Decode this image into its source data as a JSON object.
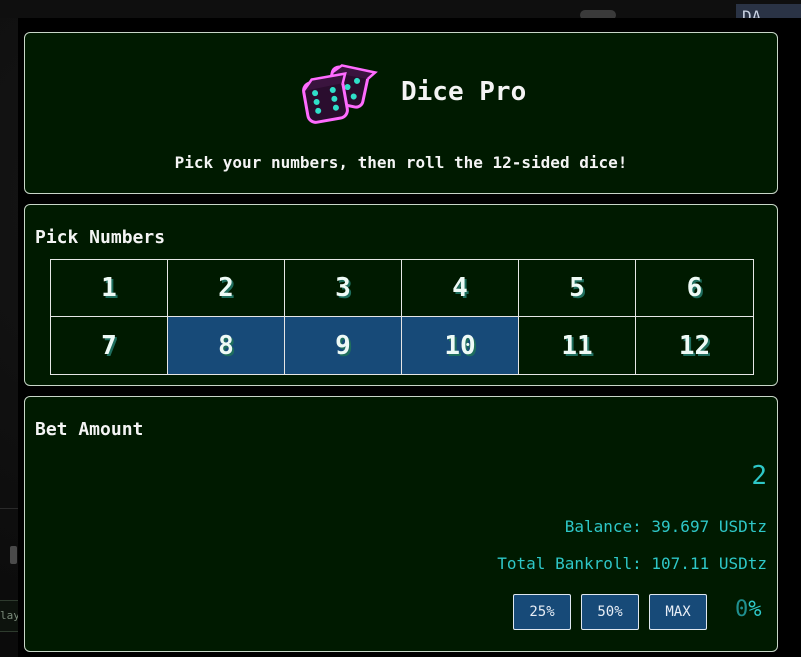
{
  "background": {
    "tab_text": "DA",
    "side_button_text": "lay"
  },
  "header": {
    "title": "Dice Pro",
    "subtitle": "Pick your numbers, then roll the 12-sided dice!"
  },
  "pick": {
    "title": "Pick Numbers",
    "numbers": [
      "1",
      "2",
      "3",
      "4",
      "5",
      "6",
      "7",
      "8",
      "9",
      "10",
      "11",
      "12"
    ],
    "selected": [
      "8",
      "9",
      "10"
    ]
  },
  "bet": {
    "title": "Bet Amount",
    "amount": "2",
    "balance_label": "Balance:",
    "balance_value": "39.697 USDtz",
    "bankroll_label": "Total Bankroll:",
    "bankroll_value": "107.11 USDtz",
    "buttons": {
      "pct25": "25%",
      "pct50": "50%",
      "max": "MAX"
    },
    "edge_value": "0",
    "edge_unit": "%"
  },
  "colors": {
    "panel_bg": "#001a00",
    "selected_cell": "#174a78",
    "accent_cyan": "#2ec7c7",
    "button_bg": "#174a78"
  },
  "icons": {
    "logo": "dice-icon"
  }
}
